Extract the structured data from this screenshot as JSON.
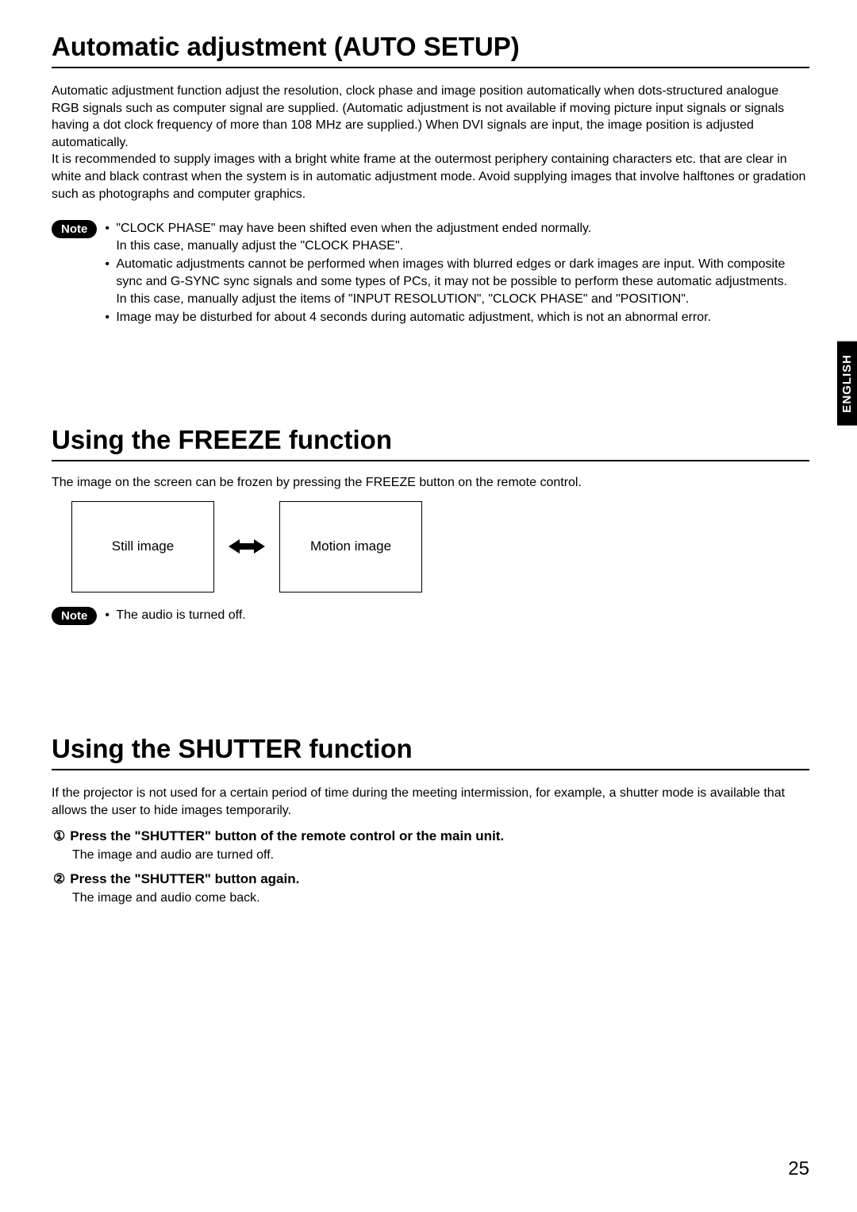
{
  "languageTab": "ENGLISH",
  "pageNumber": "25",
  "section1": {
    "heading": "Automatic adjustment (AUTO SETUP)",
    "para1": "Automatic adjustment function adjust the resolution, clock phase and image position automatically when dots-structured analogue RGB signals such as computer signal are supplied. (Automatic adjustment is not available if moving picture input signals or signals having a dot clock frequency of more than 108 MHz are supplied.) When DVI signals are input, the image position is adjusted automatically.\nIt is recommended to supply images with a bright white frame at the outermost periphery containing characters etc. that are clear in white and black contrast when the system is in automatic adjustment mode. Avoid supplying images that involve halftones or gradation such as photographs and computer graphics.",
    "noteLabel": "Note",
    "notes": [
      "\"CLOCK PHASE\" may have been shifted even when the adjustment ended normally.\nIn this case, manually adjust the \"CLOCK PHASE\".",
      "Automatic adjustments cannot be performed when images with blurred edges or dark images are input. With composite sync and G-SYNC sync signals and some types of PCs, it may not be possible to perform these automatic adjustments.\nIn this case, manually adjust the items of \"INPUT RESOLUTION\", \"CLOCK PHASE\" and \"POSITION\".",
      "Image may be disturbed for about 4 seconds during automatic adjustment, which is not an abnormal error."
    ]
  },
  "section2": {
    "heading": "Using the FREEZE function",
    "intro": "The image on the screen can be frozen by pressing the FREEZE button on the remote control.",
    "box1": "Still image",
    "box2": "Motion image",
    "noteLabel": "Note",
    "notes": [
      "The audio is turned off."
    ]
  },
  "section3": {
    "heading": "Using the SHUTTER function",
    "intro": "If the projector is not used for a certain period of time during the meeting intermission, for example, a shutter mode is available that allows the user to hide images temporarily.",
    "steps": [
      {
        "title": "Press the \"SHUTTER\" button of the remote control or the main unit.",
        "body": "The image and audio are turned off."
      },
      {
        "title": "Press the \"SHUTTER\" button again.",
        "body": "The image and audio come back."
      }
    ]
  }
}
